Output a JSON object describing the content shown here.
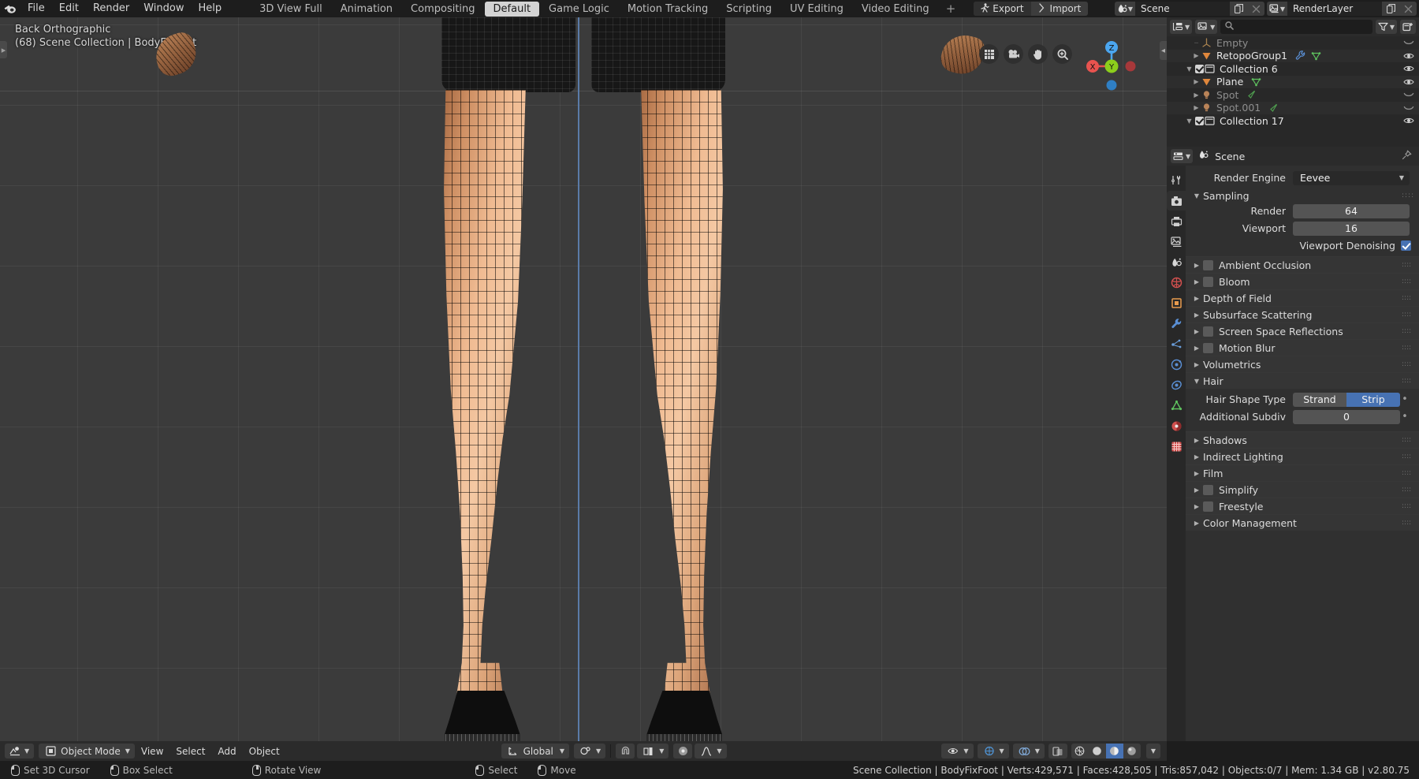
{
  "app": {
    "version_label": "v2.80.75"
  },
  "topbar": {
    "logo_icon": "blender-logo-icon",
    "menus": [
      "File",
      "Edit",
      "Render",
      "Window",
      "Help"
    ],
    "workspaces": [
      {
        "label": "3D View Full",
        "active": false
      },
      {
        "label": "Animation",
        "active": false
      },
      {
        "label": "Compositing",
        "active": false
      },
      {
        "label": "Default",
        "active": true
      },
      {
        "label": "Game Logic",
        "active": false
      },
      {
        "label": "Motion Tracking",
        "active": false
      },
      {
        "label": "Scripting",
        "active": false
      },
      {
        "label": "UV Editing",
        "active": false
      },
      {
        "label": "Video Editing",
        "active": false
      }
    ],
    "add_workspace": "+",
    "export_label": "Export",
    "import_label": "Import",
    "scene_name": "Scene",
    "viewlayer_name": "RenderLayer",
    "scene_icon": "scene-data-icon",
    "viewlayer_icon": "render-layers-icon",
    "new_icon": "duplicate-icon",
    "unlink_icon": "close-x-icon"
  },
  "viewport": {
    "view_name": "Back Orthographic",
    "collection_line": "(68) Scene Collection | BodyFixFoot",
    "nav_buttons": [
      {
        "name": "toggle-grid-icon"
      },
      {
        "name": "camera-view-icon"
      },
      {
        "name": "pan-hand-icon"
      },
      {
        "name": "zoom-magnifier-icon"
      }
    ],
    "gizmo_axes": [
      {
        "label": "Z",
        "color": "#4ba6f0"
      },
      {
        "label": "Y",
        "color": "#8cce1c"
      },
      {
        "label": "X",
        "color": "#e8534f"
      }
    ],
    "collapse_icon": "chevron-left-icon"
  },
  "viewport_header": {
    "editor_type_icon": "editor-type-3dview-icon",
    "mode_icon": "object-mode-icon",
    "mode_label": "Object Mode",
    "menus": [
      "View",
      "Select",
      "Add",
      "Object"
    ],
    "transform_orientation_icon": "orientation-icon",
    "transform_orientation": "Global",
    "snap_icon": "magnet-icon",
    "pivot_icon": "pivot-point-icon",
    "proportional_icon": "proportional-edit-icon",
    "proportional_falloff_icon": "falloff-curve-icon",
    "overlay_icon": "overlays-icon",
    "xray_icon": "xray-icon",
    "gizmo_icon": "gizmo-icon",
    "shading_modes": [
      {
        "name": "wireframe-shading-icon",
        "active": false
      },
      {
        "name": "solid-shading-icon",
        "active": false
      },
      {
        "name": "material-preview-shading-icon",
        "active": true
      },
      {
        "name": "rendered-shading-icon",
        "active": false
      }
    ]
  },
  "outliner": {
    "display_mode_icon": "outliner-display-mode-icon",
    "filter_id_icon": "filter-id-icon",
    "search_placeholder": "",
    "search_icon": "search-icon",
    "filter_icon": "filter-funnel-icon",
    "new_collection_icon": "new-collection-icon",
    "rows": [
      {
        "indent": 3,
        "tri": "",
        "checkbox": null,
        "icon": "empty-axes-icon",
        "label": "Empty",
        "dim": true,
        "data_icons": [],
        "right": "hidden-eye-closed-icon"
      },
      {
        "indent": 3,
        "tri": "▶",
        "checkbox": null,
        "icon": "mesh-data-icon",
        "label": "RetopoGroup1",
        "dim": false,
        "data_icons": [
          "modifier-wrench-icon",
          "mesh-triangle-icon"
        ],
        "right": "visible-eye-icon"
      },
      {
        "indent": 2,
        "tri": "▼",
        "checkbox": true,
        "icon": "collection-icon",
        "label": "Collection 6",
        "dim": false,
        "data_icons": [],
        "right": "visible-eye-icon"
      },
      {
        "indent": 3,
        "tri": "▶",
        "checkbox": null,
        "icon": "mesh-data-icon",
        "label": "Plane",
        "dim": false,
        "data_icons": [
          "mesh-triangle-icon"
        ],
        "right": "visible-eye-icon"
      },
      {
        "indent": 3,
        "tri": "▶",
        "checkbox": null,
        "icon": "light-bulb-icon",
        "label": "Spot",
        "dim": true,
        "data_icons": [
          "light-data-icon"
        ],
        "right": "hidden-eye-closed-icon"
      },
      {
        "indent": 3,
        "tri": "▶",
        "checkbox": null,
        "icon": "light-bulb-icon",
        "label": "Spot.001",
        "dim": true,
        "data_icons": [
          "light-data-icon"
        ],
        "right": "hidden-eye-closed-icon"
      },
      {
        "indent": 2,
        "tri": "▼",
        "checkbox": true,
        "icon": "collection-icon",
        "label": "Collection 17",
        "dim": false,
        "data_icons": [],
        "right": "visible-eye-icon"
      }
    ]
  },
  "properties": {
    "editor_icon": "properties-editor-icon",
    "breadcrumb_icon": "scene-data-icon",
    "breadcrumb": "Scene",
    "pin_icon": "pin-icon",
    "tabs": [
      {
        "name": "tool-tab-icon",
        "active": false
      },
      {
        "name": "render-tab-icon",
        "active": true
      },
      {
        "name": "output-tab-icon",
        "active": false
      },
      {
        "name": "view-layer-tab-icon",
        "active": false
      },
      {
        "name": "scene-tab-icon",
        "active": false
      },
      {
        "name": "world-tab-icon",
        "active": false
      },
      {
        "name": "object-tab-icon",
        "active": false
      },
      {
        "name": "modifier-tab-icon",
        "active": false
      },
      {
        "name": "particles-tab-icon",
        "active": false
      },
      {
        "name": "physics-tab-icon",
        "active": false
      },
      {
        "name": "constraints-tab-icon",
        "active": false
      },
      {
        "name": "object-data-tab-icon",
        "active": false
      },
      {
        "name": "material-tab-icon",
        "active": false
      },
      {
        "name": "texture-tab-icon",
        "active": false
      }
    ],
    "render_engine_label": "Render Engine",
    "render_engine_value": "Eevee",
    "sampling": {
      "title": "Sampling",
      "render_label": "Render",
      "render_value": "64",
      "viewport_label": "Viewport",
      "viewport_value": "16",
      "denoise_label": "Viewport Denoising",
      "denoise_checked": true
    },
    "panels": [
      {
        "label": "Ambient Occlusion",
        "checkbox": true,
        "open": false
      },
      {
        "label": "Bloom",
        "checkbox": true,
        "open": false
      },
      {
        "label": "Depth of Field",
        "checkbox": false,
        "open": false
      },
      {
        "label": "Subsurface Scattering",
        "checkbox": false,
        "open": false
      },
      {
        "label": "Screen Space Reflections",
        "checkbox": true,
        "open": false
      },
      {
        "label": "Motion Blur",
        "checkbox": true,
        "open": false
      },
      {
        "label": "Volumetrics",
        "checkbox": false,
        "open": false
      }
    ],
    "hair": {
      "title": "Hair",
      "shape_type_label": "Hair Shape Type",
      "shape_options": [
        "Strand",
        "Strip"
      ],
      "shape_selected": "Strip",
      "subdiv_label": "Additional Subdiv",
      "subdiv_value": "0"
    },
    "panels_after": [
      {
        "label": "Shadows",
        "checkbox": false,
        "open": false
      },
      {
        "label": "Indirect Lighting",
        "checkbox": false,
        "open": false
      },
      {
        "label": "Film",
        "checkbox": false,
        "open": false
      },
      {
        "label": "Simplify",
        "checkbox": true,
        "open": false
      },
      {
        "label": "Freestyle",
        "checkbox": true,
        "open": false
      },
      {
        "label": "Color Management",
        "checkbox": false,
        "open": false
      }
    ]
  },
  "statusbar": {
    "keymap": [
      {
        "mouse": "l",
        "label": "Set 3D Cursor"
      },
      {
        "mouse": "l",
        "label": "Box Select"
      },
      {
        "mouse": "m",
        "label": "Rotate View"
      },
      {
        "mouse": "l",
        "label": "Select"
      },
      {
        "mouse": "l",
        "label": "Move"
      }
    ],
    "stats": "Scene Collection | BodyFixFoot | Verts:429,571 | Faces:428,505 | Tris:857,042 | Objects:0/7 | Mem: 1.34 GB | v2.80.75"
  },
  "colors": {
    "accent_blue": "#4772b3",
    "axis_x": "#e8534f",
    "axis_y": "#8cce1c",
    "axis_z": "#4ba6f0",
    "bg_dark": "#1d1d1d",
    "viewport_bg": "#3b3b3b"
  }
}
